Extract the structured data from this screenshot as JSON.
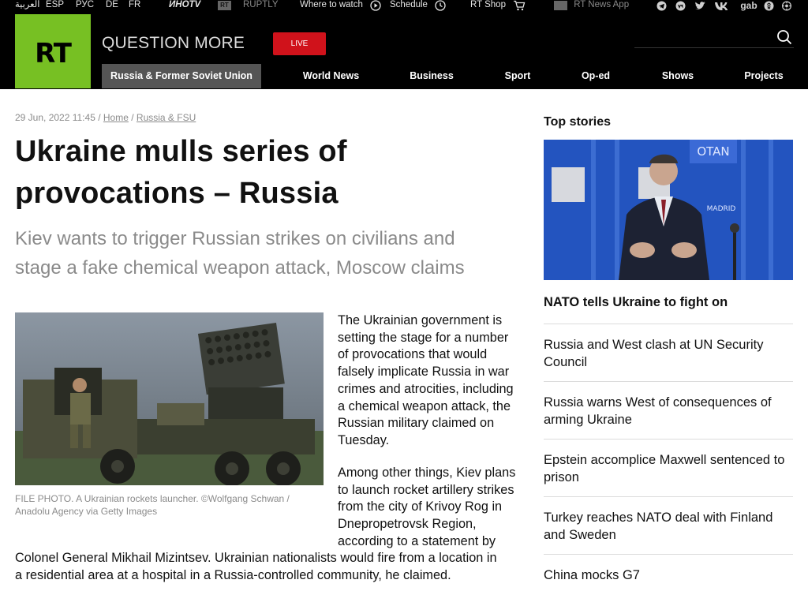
{
  "utility_bar": {
    "languages": [
      "العربية",
      "ESP",
      "РУС",
      "DE",
      "FR"
    ],
    "partners": [
      "ИНОTV",
      "RT",
      "RUPTLY"
    ],
    "where_to_watch": "Where to watch",
    "schedule": "Schedule",
    "shop": "RT Shop",
    "app": "RT News App",
    "social": [
      "telegram-icon",
      "vk-circle-icon",
      "twitter-icon",
      "vk-icon",
      "gab",
      "odnoklassniki-icon",
      "settings-icon"
    ],
    "gab_label": "gab"
  },
  "header": {
    "logo": "RT",
    "tagline": "QUESTION MORE",
    "live_label": "LIVE",
    "nav": [
      "Russia & Former Soviet Union",
      "World News",
      "Business",
      "Sport",
      "Op-ed",
      "Shows",
      "Projects"
    ],
    "active_nav": "Russia & Former Soviet Union",
    "brand_color": "#77c023",
    "live_color": "#d0121b"
  },
  "article": {
    "date": "29 Jun, 2022 11:45",
    "breadcrumb": [
      "Home",
      "Russia & FSU"
    ],
    "title_line1": "Ukraine mulls series of",
    "title_line2": "provocations – Russia",
    "summary_line1": "Kiev wants to trigger Russian strikes on civilians and",
    "summary_line2": "stage a fake chemical weapon attack, Moscow claims",
    "caption_line1": "FILE PHOTO. A Ukrainian rockets launcher. ©Wolfgang Schwan /",
    "caption_line2": "Anadolu Agency via Getty Images",
    "para1_lines": [
      "The Ukrainian government is",
      "setting the stage for a number",
      "of provocations that would",
      "falsely implicate Russia in war",
      "crimes and atrocities, including",
      "a chemical weapon attack, the",
      "Russian military claimed on",
      "Tuesday."
    ],
    "para2_lines": [
      "Among other things, Kiev plans",
      "to launch rocket artillery strikes",
      "from the city of Krivoy Rog in",
      "Dnepropetrovsk Region,",
      "according to a statement by"
    ],
    "para2_full_lines": [
      "Colonel General Mikhail Mizintsev. Ukrainian nationalists would fire from a location in",
      "a residential area at a hospital in a Russia-controlled community, he claimed."
    ]
  },
  "sidebar": {
    "heading": "Top stories",
    "lead_story": "NATO tells Ukraine to fight on",
    "stories": [
      [
        "Russia and West clash at UN Security",
        "Council"
      ],
      [
        "Russia warns West of consequences of",
        "arming Ukraine"
      ],
      [
        "Epstein accomplice Maxwell sentenced to",
        "prison"
      ],
      [
        "Turkey reaches NATO deal with Finland",
        "and Sweden"
      ],
      [
        "China mocks G7"
      ]
    ],
    "photo_sign_text": "OTAN",
    "photo_sign_city": "MADRID"
  }
}
